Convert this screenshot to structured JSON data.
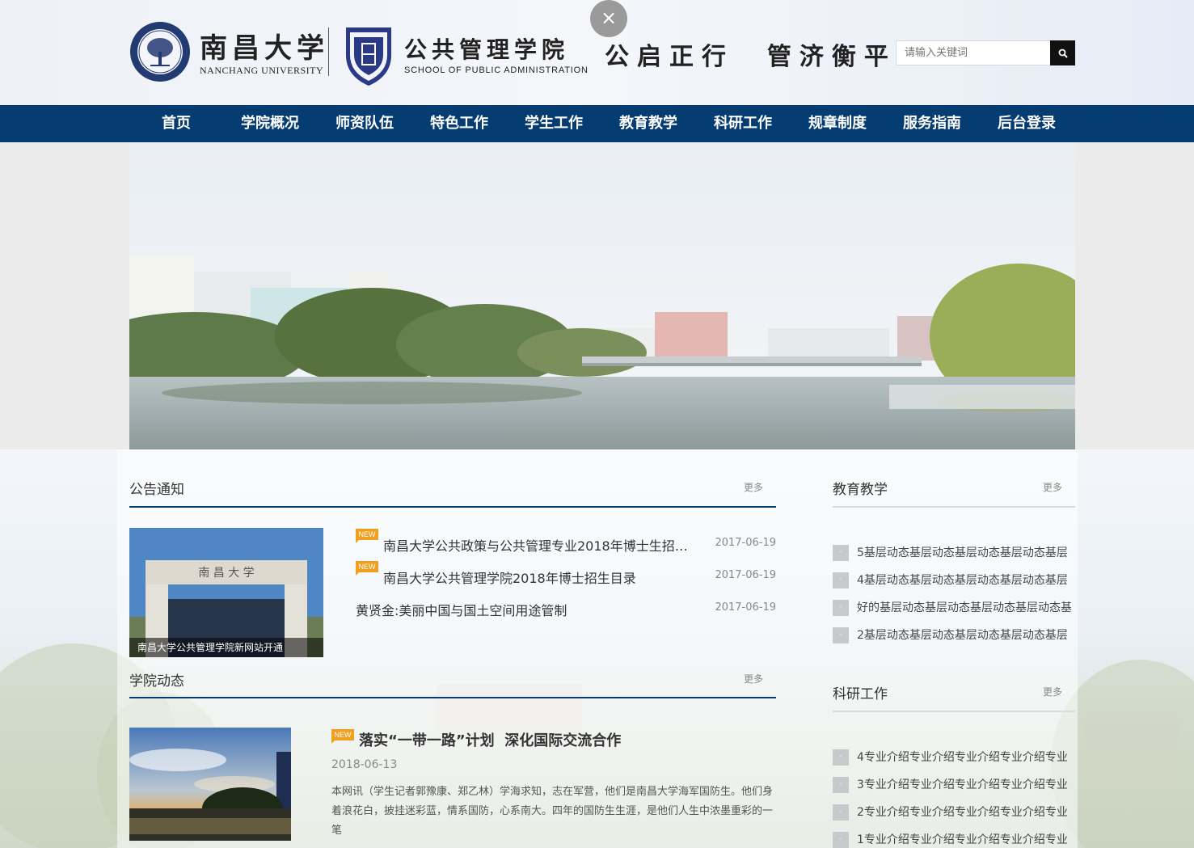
{
  "header": {
    "ncu_name_cn": "南昌大学",
    "ncu_name_en": "NANCHANG UNIVERSITY",
    "school_name_cn": "公共管理学院",
    "school_name_en": "SCHOOL OF PUBLIC ADMINISTRATION",
    "motto": "公启正行  管济衡平",
    "close_label": "×",
    "search": {
      "placeholder": "请输入关键词"
    }
  },
  "nav": {
    "items": [
      {
        "label": "首页"
      },
      {
        "label": "学院概况"
      },
      {
        "label": "师资队伍"
      },
      {
        "label": "特色工作"
      },
      {
        "label": "学生工作"
      },
      {
        "label": "教育教学"
      },
      {
        "label": "科研工作"
      },
      {
        "label": "规章制度"
      },
      {
        "label": "服务指南"
      },
      {
        "label": "后台登录"
      }
    ]
  },
  "notices": {
    "title": "公告通知",
    "more": "更多",
    "image_caption": "南昌大学公共管理学院新网站开通",
    "image_sign": "南 昌 大 学",
    "new_label": "NEW",
    "items": [
      {
        "text": "南昌大学公共政策与公共管理专业2018年博士生招生...",
        "date": "2017-06-19",
        "is_new": true
      },
      {
        "text": "南昌大学公共管理学院2018年博士招生目录",
        "date": "2017-06-19",
        "is_new": true
      },
      {
        "text": "黄贤金:美丽中国与国土空间用途管制",
        "date": "2017-06-19",
        "is_new": false
      }
    ]
  },
  "news": {
    "title": "学院动态",
    "more": "更多",
    "new_label": "NEW",
    "headline": "落实“一带一路”计划  深化国际交流合作",
    "date": "2018-06-13",
    "summary": "本网讯（学生记者郭豫康、郑乙林）学海求知，志在军营，他们是南昌大学海军国防生。他们身着浪花白，披挂迷彩蓝，情系国防，心系南大。四年的国防生生涯，是他们人生中浓墨重彩的一笔"
  },
  "teaching": {
    "title": "教育教学",
    "more": "更多",
    "bullet": "·",
    "items": [
      {
        "text": "5基层动态基层动态基层动态基层动态基层"
      },
      {
        "text": "4基层动态基层动态基层动态基层动态基层"
      },
      {
        "text": "好的基层动态基层动态基层动态基层动态基"
      },
      {
        "text": "2基层动态基层动态基层动态基层动态基层"
      }
    ]
  },
  "research": {
    "title": "科研工作",
    "more": "更多",
    "bullet": "·",
    "items": [
      {
        "text": "4专业介绍专业介绍专业介绍专业介绍专业"
      },
      {
        "text": "3专业介绍专业介绍专业介绍专业介绍专业"
      },
      {
        "text": "2专业介绍专业介绍专业介绍专业介绍专业"
      },
      {
        "text": "1专业介绍专业介绍专业介绍专业介绍专业"
      }
    ]
  }
}
